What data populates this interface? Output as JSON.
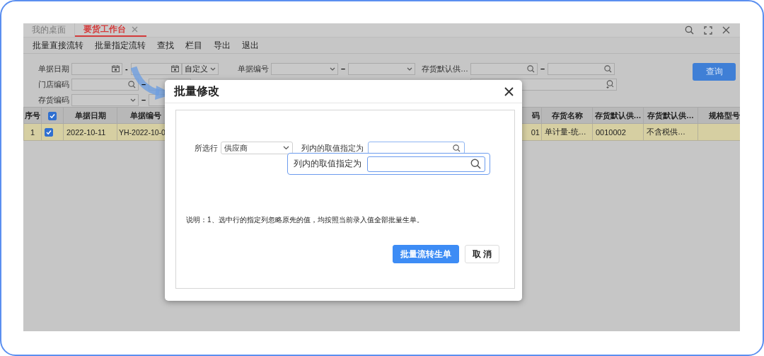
{
  "tabs": [
    {
      "label": "我的桌面",
      "selected": false,
      "closable": false
    },
    {
      "label": "要货工作台",
      "selected": true,
      "closable": true
    }
  ],
  "toolbar": [
    "批量直接流转",
    "批量指定流转",
    "查找",
    "栏目",
    "导出",
    "退出"
  ],
  "filter_columns": [
    {
      "rows": [
        {
          "label": "单据日期",
          "fields": [
            {
              "kind": "date"
            },
            {
              "kind": "sep",
              "text": "-"
            },
            {
              "kind": "date"
            },
            {
              "kind": "select-short",
              "value": "自定义"
            }
          ]
        },
        {
          "label": "门店编码",
          "fields": [
            {
              "kind": "search"
            },
            {
              "kind": "sep",
              "text": "–"
            },
            {
              "kind": "plain"
            }
          ]
        },
        {
          "label": "存货编码",
          "fields": [
            {
              "kind": "select"
            },
            {
              "kind": "sep",
              "text": "–"
            },
            {
              "kind": "plain"
            }
          ]
        }
      ]
    },
    {
      "rows": [
        {
          "label": "单据编号",
          "fields": [
            {
              "kind": "select"
            },
            {
              "kind": "sep",
              "text": "–"
            },
            {
              "kind": "select"
            }
          ]
        }
      ]
    },
    {
      "rows": [
        {
          "label": "存货默认供…",
          "fields": [
            {
              "kind": "search"
            },
            {
              "kind": "sep",
              "text": "–"
            },
            {
              "kind": "search"
            }
          ]
        },
        {
          "fields": [
            {
              "kind": "search-plus"
            }
          ]
        }
      ]
    }
  ],
  "query_button": "查询",
  "table": {
    "columns": [
      {
        "kind": "text",
        "label": "序号"
      },
      {
        "kind": "check",
        "checked": true
      },
      {
        "kind": "text",
        "label": "单据日期"
      },
      {
        "kind": "text",
        "label": "单据编号"
      },
      {
        "kind": "text",
        "label": "码"
      },
      {
        "kind": "text",
        "label": "存货名称"
      },
      {
        "kind": "text",
        "label": "存货默认供…"
      },
      {
        "kind": "text",
        "label": "存货默认供…"
      },
      {
        "kind": "text",
        "label": "规格型号"
      }
    ],
    "rows": [
      {
        "selected": true,
        "checked": true,
        "cells": [
          "1",
          "",
          "2022-10-11",
          "YH-2022-10-0",
          "01",
          "单计量-统…",
          "0010002",
          "不含税供…"
        ]
      }
    ]
  },
  "dialog": {
    "title": "批量修改",
    "row_label": "所选行",
    "row_select": "供应商",
    "value_label": "列内的取值指定为",
    "callout_label": "列内的取值指定为",
    "note": "说明：1、选中行的指定列忽略原先的值，均按照当前录入值全部批量生单。",
    "buttons": [
      {
        "label": "批量流转生单",
        "kind": "primary"
      },
      {
        "label": "取 消",
        "kind": "default"
      }
    ]
  }
}
